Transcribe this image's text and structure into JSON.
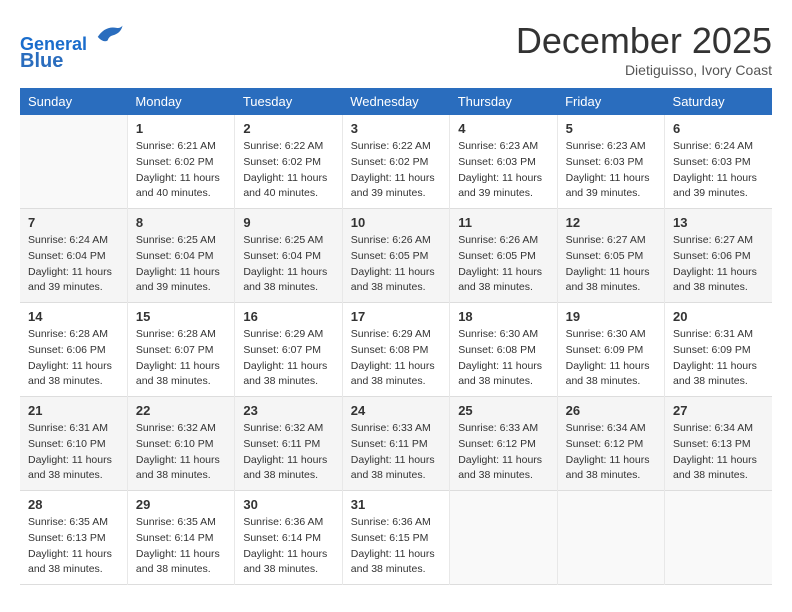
{
  "logo": {
    "line1": "General",
    "line2": "Blue"
  },
  "title": "December 2025",
  "subtitle": "Dietiguisso, Ivory Coast",
  "weekdays": [
    "Sunday",
    "Monday",
    "Tuesday",
    "Wednesday",
    "Thursday",
    "Friday",
    "Saturday"
  ],
  "weeks": [
    [
      {
        "day": "",
        "info": ""
      },
      {
        "day": "1",
        "info": "Sunrise: 6:21 AM\nSunset: 6:02 PM\nDaylight: 11 hours\nand 40 minutes."
      },
      {
        "day": "2",
        "info": "Sunrise: 6:22 AM\nSunset: 6:02 PM\nDaylight: 11 hours\nand 40 minutes."
      },
      {
        "day": "3",
        "info": "Sunrise: 6:22 AM\nSunset: 6:02 PM\nDaylight: 11 hours\nand 39 minutes."
      },
      {
        "day": "4",
        "info": "Sunrise: 6:23 AM\nSunset: 6:03 PM\nDaylight: 11 hours\nand 39 minutes."
      },
      {
        "day": "5",
        "info": "Sunrise: 6:23 AM\nSunset: 6:03 PM\nDaylight: 11 hours\nand 39 minutes."
      },
      {
        "day": "6",
        "info": "Sunrise: 6:24 AM\nSunset: 6:03 PM\nDaylight: 11 hours\nand 39 minutes."
      }
    ],
    [
      {
        "day": "7",
        "info": "Sunrise: 6:24 AM\nSunset: 6:04 PM\nDaylight: 11 hours\nand 39 minutes."
      },
      {
        "day": "8",
        "info": "Sunrise: 6:25 AM\nSunset: 6:04 PM\nDaylight: 11 hours\nand 39 minutes."
      },
      {
        "day": "9",
        "info": "Sunrise: 6:25 AM\nSunset: 6:04 PM\nDaylight: 11 hours\nand 38 minutes."
      },
      {
        "day": "10",
        "info": "Sunrise: 6:26 AM\nSunset: 6:05 PM\nDaylight: 11 hours\nand 38 minutes."
      },
      {
        "day": "11",
        "info": "Sunrise: 6:26 AM\nSunset: 6:05 PM\nDaylight: 11 hours\nand 38 minutes."
      },
      {
        "day": "12",
        "info": "Sunrise: 6:27 AM\nSunset: 6:05 PM\nDaylight: 11 hours\nand 38 minutes."
      },
      {
        "day": "13",
        "info": "Sunrise: 6:27 AM\nSunset: 6:06 PM\nDaylight: 11 hours\nand 38 minutes."
      }
    ],
    [
      {
        "day": "14",
        "info": "Sunrise: 6:28 AM\nSunset: 6:06 PM\nDaylight: 11 hours\nand 38 minutes."
      },
      {
        "day": "15",
        "info": "Sunrise: 6:28 AM\nSunset: 6:07 PM\nDaylight: 11 hours\nand 38 minutes."
      },
      {
        "day": "16",
        "info": "Sunrise: 6:29 AM\nSunset: 6:07 PM\nDaylight: 11 hours\nand 38 minutes."
      },
      {
        "day": "17",
        "info": "Sunrise: 6:29 AM\nSunset: 6:08 PM\nDaylight: 11 hours\nand 38 minutes."
      },
      {
        "day": "18",
        "info": "Sunrise: 6:30 AM\nSunset: 6:08 PM\nDaylight: 11 hours\nand 38 minutes."
      },
      {
        "day": "19",
        "info": "Sunrise: 6:30 AM\nSunset: 6:09 PM\nDaylight: 11 hours\nand 38 minutes."
      },
      {
        "day": "20",
        "info": "Sunrise: 6:31 AM\nSunset: 6:09 PM\nDaylight: 11 hours\nand 38 minutes."
      }
    ],
    [
      {
        "day": "21",
        "info": "Sunrise: 6:31 AM\nSunset: 6:10 PM\nDaylight: 11 hours\nand 38 minutes."
      },
      {
        "day": "22",
        "info": "Sunrise: 6:32 AM\nSunset: 6:10 PM\nDaylight: 11 hours\nand 38 minutes."
      },
      {
        "day": "23",
        "info": "Sunrise: 6:32 AM\nSunset: 6:11 PM\nDaylight: 11 hours\nand 38 minutes."
      },
      {
        "day": "24",
        "info": "Sunrise: 6:33 AM\nSunset: 6:11 PM\nDaylight: 11 hours\nand 38 minutes."
      },
      {
        "day": "25",
        "info": "Sunrise: 6:33 AM\nSunset: 6:12 PM\nDaylight: 11 hours\nand 38 minutes."
      },
      {
        "day": "26",
        "info": "Sunrise: 6:34 AM\nSunset: 6:12 PM\nDaylight: 11 hours\nand 38 minutes."
      },
      {
        "day": "27",
        "info": "Sunrise: 6:34 AM\nSunset: 6:13 PM\nDaylight: 11 hours\nand 38 minutes."
      }
    ],
    [
      {
        "day": "28",
        "info": "Sunrise: 6:35 AM\nSunset: 6:13 PM\nDaylight: 11 hours\nand 38 minutes."
      },
      {
        "day": "29",
        "info": "Sunrise: 6:35 AM\nSunset: 6:14 PM\nDaylight: 11 hours\nand 38 minutes."
      },
      {
        "day": "30",
        "info": "Sunrise: 6:36 AM\nSunset: 6:14 PM\nDaylight: 11 hours\nand 38 minutes."
      },
      {
        "day": "31",
        "info": "Sunrise: 6:36 AM\nSunset: 6:15 PM\nDaylight: 11 hours\nand 38 minutes."
      },
      {
        "day": "",
        "info": ""
      },
      {
        "day": "",
        "info": ""
      },
      {
        "day": "",
        "info": ""
      }
    ]
  ]
}
